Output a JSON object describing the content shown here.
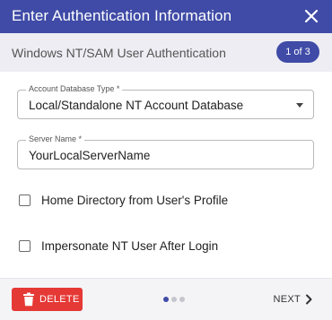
{
  "dialog": {
    "title": "Enter Authentication Information",
    "subtitle": "Windows NT/SAM User Authentication",
    "step_badge": "1 of 3",
    "header_color": "#3f4ba6"
  },
  "form": {
    "account_db": {
      "label": "Account Database Type *",
      "value": "Local/Standalone NT Account Database"
    },
    "server_name": {
      "label": "Server Name *",
      "value": "YourLocalServerName"
    },
    "home_directory": {
      "label": "Home Directory from User's Profile",
      "checked": false
    },
    "impersonate": {
      "label": "Impersonate NT User After Login",
      "checked": false
    }
  },
  "footer": {
    "delete_label": "DELETE",
    "delete_color": "#e53935",
    "next_label": "NEXT",
    "pagination": {
      "total": 3,
      "active": 1
    }
  }
}
